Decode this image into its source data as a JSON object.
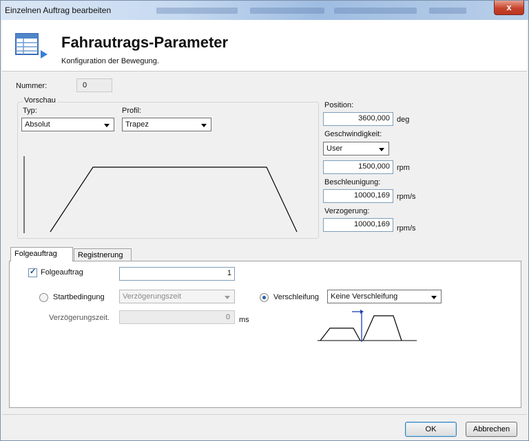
{
  "window": {
    "title": "Einzelnen Auftrag bearbeiten",
    "close_glyph": "x"
  },
  "header": {
    "title": "Fahrautrags-Parameter",
    "subtitle": "Konfiguration der Bewegung.",
    "icon": "table-list-icon"
  },
  "nummer": {
    "label": "Nummer:",
    "value": "0"
  },
  "vorschau": {
    "caption": "Vorschau",
    "typ_label": "Typ:",
    "typ_value": "Absolut",
    "profil_label": "Profil:",
    "profil_value": "Trapez",
    "profile_shape": "trapezoid"
  },
  "params": {
    "position_label": "Position:",
    "position_value": "3600,000",
    "position_unit": "deg",
    "geschwindigkeit_label": "Geschwindigkeit:",
    "geschwindigkeit_mode": "User",
    "geschwindigkeit_value": "1500,000",
    "geschwindigkeit_unit": "rpm",
    "beschleunigung_label": "Beschleunigung:",
    "beschleunigung_value": "10000,169",
    "beschleunigung_unit": "rpm/s",
    "verzogerung_label": "Verzogerung:",
    "verzogerung_value": "10000,169",
    "verzogerung_unit": "rpm/s"
  },
  "tabs": [
    {
      "label": "Folgeauftrag",
      "active": true
    },
    {
      "label": "Registnerung",
      "active": false
    }
  ],
  "folge": {
    "checkbox_label": "Folgeauftrag",
    "checked": true,
    "value": "1",
    "startbedingung_label": "Startbedingung",
    "startbedingung_value": "Verzögerungszeit",
    "verzoegerungszeit_label": "Verzögerungszeit.",
    "verzoegerungszeit_value": "0",
    "verzoegerungszeit_unit": "ms",
    "verschleifung_label": "Verschleifung",
    "verschleifung_value": "Keine Verschleifung"
  },
  "buttons": {
    "ok": "OK",
    "cancel": "Abbrechen"
  },
  "colors": {
    "accent_blue": "#2b5fa8",
    "title_bar": "#c5d9f0",
    "close_red": "#c9432c"
  }
}
